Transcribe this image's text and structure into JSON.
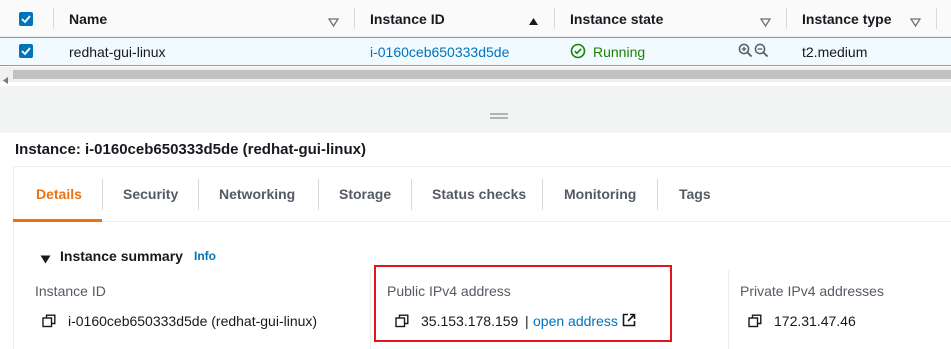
{
  "table": {
    "columns": [
      {
        "label": "Name",
        "sort": "none"
      },
      {
        "label": "Instance ID",
        "sort": "ascending"
      },
      {
        "label": "Instance state",
        "sort": "none"
      },
      {
        "label": "Instance type",
        "sort": "none"
      }
    ],
    "rows": [
      {
        "selected": true,
        "name": "redhat-gui-linux",
        "instance_id": "i-0160ceb650333d5de",
        "state": "Running",
        "instance_type": "t2.medium"
      }
    ]
  },
  "detail": {
    "title": "Instance: i-0160ceb650333d5de (redhat-gui-linux)",
    "tabs": [
      "Details",
      "Security",
      "Networking",
      "Storage",
      "Status checks",
      "Monitoring",
      "Tags"
    ],
    "active_tab": "Details",
    "summary": {
      "heading": "Instance summary",
      "info_label": "Info",
      "fields": [
        {
          "label": "Instance ID",
          "value": "i-0160ceb650333d5de (redhat-gui-linux)"
        },
        {
          "label": "Public IPv4 address",
          "value": "35.153.178.159",
          "separator": "|",
          "link": "open address"
        },
        {
          "label": "Private IPv4 addresses",
          "value": "172.31.47.46"
        }
      ]
    }
  },
  "colors": {
    "accent_blue": "#0073bb",
    "running_green": "#1d8102",
    "active_tab_orange": "#ec7211",
    "highlight_red": "#e0161c"
  }
}
